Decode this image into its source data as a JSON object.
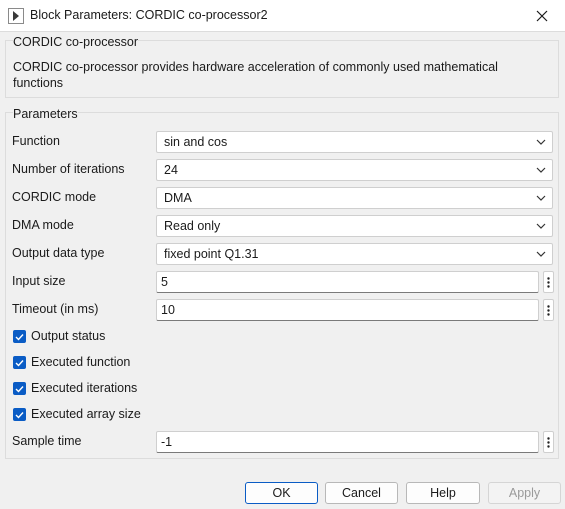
{
  "window": {
    "title": "Block Parameters: CORDIC co-processor2"
  },
  "description": {
    "group_title": "CORDIC co-processor",
    "text": "CORDIC co-processor provides hardware acceleration of commonly used mathematical functions"
  },
  "parameters": {
    "group_title": "Parameters",
    "function": {
      "label": "Function",
      "value": "sin and cos"
    },
    "iterations": {
      "label": "Number of iterations",
      "value": "24"
    },
    "cordic_mode": {
      "label": "CORDIC mode",
      "value": "DMA"
    },
    "dma_mode": {
      "label": "DMA mode",
      "value": "Read only"
    },
    "output_type": {
      "label": "Output data type",
      "value": "fixed point Q1.31"
    },
    "input_size": {
      "label": "Input size",
      "value": "5"
    },
    "timeout": {
      "label": "Timeout (in ms)",
      "value": "10"
    },
    "checkboxes": [
      {
        "label": "Output status",
        "checked": true
      },
      {
        "label": "Executed function",
        "checked": true
      },
      {
        "label": "Executed iterations",
        "checked": true
      },
      {
        "label": "Executed array size",
        "checked": true
      }
    ],
    "sample_time": {
      "label": "Sample time",
      "value": "-1"
    }
  },
  "buttons": {
    "ok": "OK",
    "cancel": "Cancel",
    "help": "Help",
    "apply": "Apply"
  },
  "icons": {
    "close": "close-icon",
    "dropdown": "chevron-down-icon",
    "options": "kebab-menu-icon",
    "check": "checkmark-icon"
  },
  "colors": {
    "accent": "#0a5cc5",
    "background": "#f0f0f0"
  }
}
